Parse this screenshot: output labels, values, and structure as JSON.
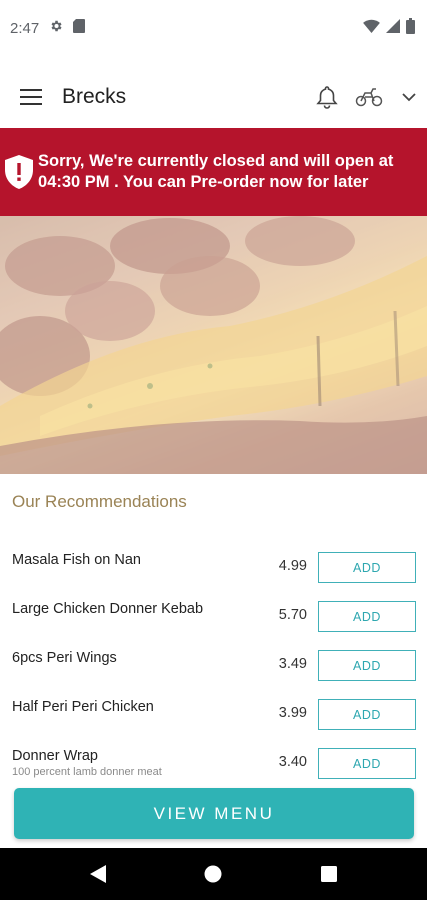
{
  "status_bar": {
    "time": "2:47",
    "icons": [
      "gear-icon",
      "sd-card-icon",
      "wifi-icon",
      "signal-icon",
      "battery-icon"
    ]
  },
  "app_bar": {
    "title": "Brecks",
    "icons": [
      "menu-icon",
      "bell-icon",
      "delivery-scooter-icon",
      "chevron-down-icon"
    ]
  },
  "banner": {
    "message": "Sorry, We're currently closed and will open at 04:30 PM . You can Pre-order now for later",
    "icon": "shield-alert-icon",
    "color": "#b5142c"
  },
  "recommendations": {
    "heading": "Our Recommendations",
    "add_label": "ADD",
    "items": [
      {
        "name": "Masala Fish on Nan",
        "description": "",
        "price": "4.99"
      },
      {
        "name": "Large Chicken Donner Kebab",
        "description": "",
        "price": "5.70"
      },
      {
        "name": "6pcs Peri Wings",
        "description": "",
        "price": "3.49"
      },
      {
        "name": "Half Peri Peri Chicken",
        "description": "",
        "price": "3.99"
      },
      {
        "name": "Donner Wrap",
        "description": "100 percent lamb donner meat",
        "price": "3.40"
      }
    ]
  },
  "view_menu": {
    "label": "VIEW MENU",
    "color": "#2fb3b5"
  },
  "nav_bar": {
    "icons": [
      "back-icon",
      "home-icon",
      "recents-icon"
    ]
  }
}
